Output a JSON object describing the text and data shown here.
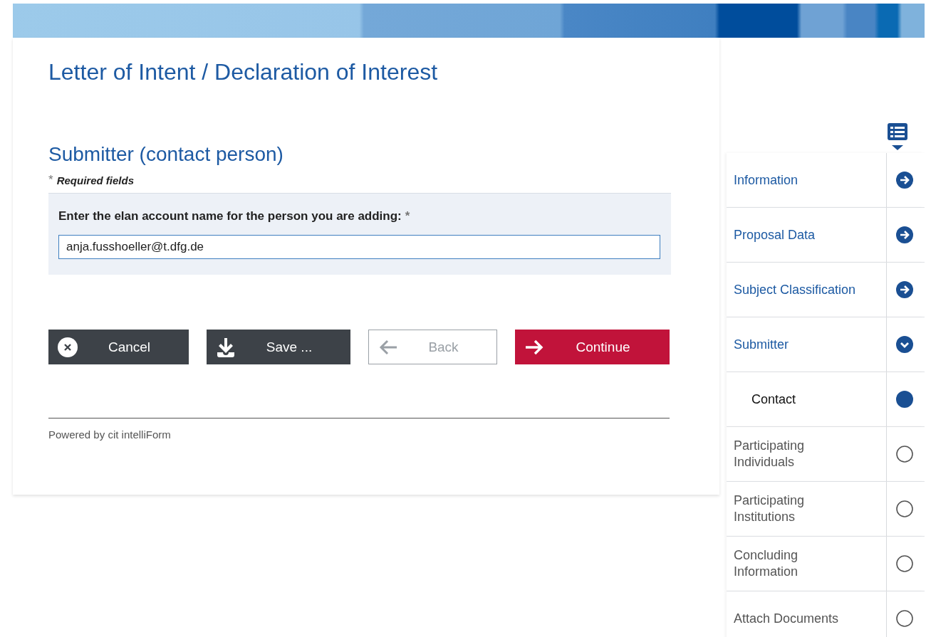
{
  "page_title": "Letter of Intent / Declaration of Interest",
  "section_title": "Submitter (contact person)",
  "required_note": {
    "mark": "*",
    "text": "Required fields"
  },
  "form": {
    "label": "Enter the elan account name for the person you are adding:",
    "required_mark": "*",
    "value": "anja.fusshoeller@t.dfg.de"
  },
  "buttons": [
    {
      "kind": "cancel",
      "label": "Cancel",
      "disabled": false
    },
    {
      "kind": "save",
      "label": "Save ...",
      "disabled": false
    },
    {
      "kind": "back",
      "label": "Back",
      "disabled": true
    },
    {
      "kind": "continue",
      "label": "Continue",
      "disabled": false
    }
  ],
  "footer": "Powered by cit intelliForm",
  "nav": [
    {
      "label": "Information",
      "kind": "done",
      "selected": false
    },
    {
      "label": "Proposal Data",
      "kind": "done",
      "selected": false
    },
    {
      "label": "Subject Classification",
      "kind": "done",
      "selected": false
    },
    {
      "label": "Submitter",
      "kind": "expanded",
      "selected": false,
      "children": [
        {
          "label": "Contact",
          "kind": "current",
          "selected": true
        }
      ]
    },
    {
      "label": "Participating Individuals",
      "kind": "todo",
      "selected": false
    },
    {
      "label": "Participating Institutions",
      "kind": "todo",
      "selected": false
    },
    {
      "label": "Concluding Information",
      "kind": "todo",
      "selected": false
    },
    {
      "label": "Attach Documents",
      "kind": "todo",
      "selected": false
    }
  ]
}
